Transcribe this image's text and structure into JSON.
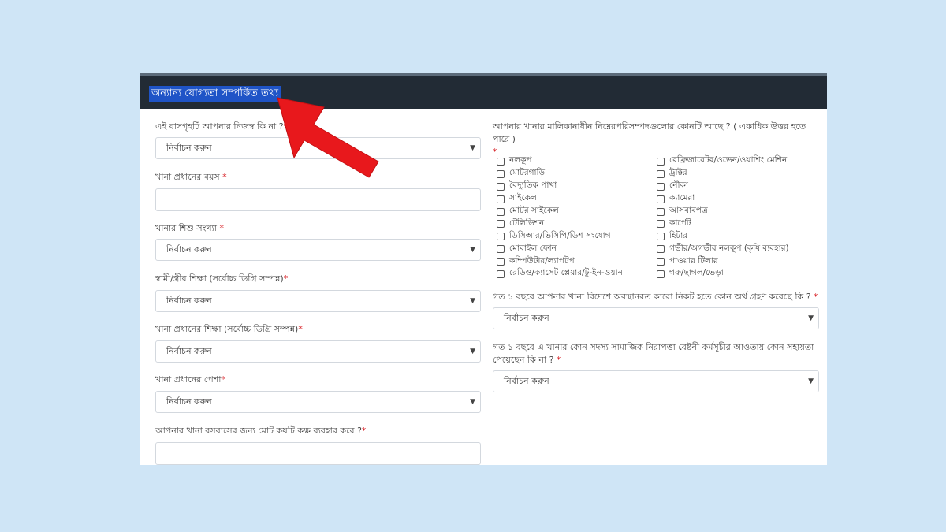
{
  "header": {
    "title": "অন্যান্য যোগ্যতা সম্পর্কিত তথ্য"
  },
  "left_fields": {
    "house_own": {
      "label": "এই বাসগৃহটি আপনার নিজস্ব কি না ?",
      "required": "*",
      "value": "নির্বাচন করুন"
    },
    "head_age": {
      "label": "খানা প্রধানের বয়স",
      "required": " *",
      "value": ""
    },
    "child_count": {
      "label": "খানার শিশু সংখ্যা",
      "required": " *",
      "value": "নির্বাচন করুন"
    },
    "spouse_edu": {
      "label": "স্বামী/স্ত্রীর শিক্ষা (সর্বোচ্চ ডিগ্রি সম্পন্ন)",
      "required": "*",
      "value": "নির্বাচন করুন"
    },
    "head_edu": {
      "label": "খানা প্রধানের শিক্ষা (সর্বোচ্চ ডিগ্রি সম্পন্ন)",
      "required": "*",
      "value": "নির্বাচন করুন"
    },
    "head_job": {
      "label": "খানা প্রধানের পেশা",
      "required": "*",
      "value": "নির্বাচন করুন"
    },
    "rooms": {
      "label": "আপনার খানা বসবাসের জন্য মোট কয়টি কক্ষ ব্যবহার করে ?",
      "required": "*",
      "value": ""
    }
  },
  "assets": {
    "label": "আপনার খানার মালিকানাধীন নিম্নেরপরিসম্পদগুলোর কোনটি আছে ? ( একাধিক উত্তর হতে পারে )",
    "required": "*",
    "col1": [
      "নলকূপ",
      "মোটরগাড়ি",
      "বৈদ্যুতিক পাখা",
      "সাইকেল",
      "মোটর সাইকেল",
      "টেলিভিশন",
      "ডিসিআর/ভিসিপি/ডিশ সংযোগ",
      "মোবাইল ফোন",
      "কম্পিউটার/ল্যাপটপ",
      "রেডিও/ক্যাসেট প্লেয়ার/টু-ইন-ওয়ান"
    ],
    "col2": [
      "রেফ্রিজারেটর/ওভেন/ওয়াশিং মেশিন",
      "ট্রাক্টর",
      "নৌকা",
      "ক্যামেরা",
      "আসবাবপত্র",
      "কার্পেট",
      "হিটার",
      "গভীর/অগভীর নলকূপ (কৃষি ব্যবহার)",
      "পাওয়ার টিলার",
      "গরু/ছাগল/ভেড়া"
    ]
  },
  "right_fields": {
    "remittance": {
      "label": "গত ১ বছরে আপনার খানা বিদেশে অবস্থানরত কারো নিকট হতে কোন অর্থ গ্রহণ করেছে কি ?",
      "required": " *",
      "value": "নির্বাচন করুন"
    },
    "safety_net_1": {
      "label": "গত ১ বছরে এ খানার কোন সদস্য সামাজিক নিরাপত্তা বেষ্টনী কর্মসূচীর আওতায় কোন সহায়তা",
      "label2": "পেয়েছেন কি না ?",
      "required": " *",
      "value": "নির্বাচন করুন"
    }
  },
  "colors": {
    "header_bg": "#222b35",
    "title_highlight": "#1f54c7",
    "required": "#d9262b",
    "arrow": "#e8181c",
    "page_bg": "#cfe5f6"
  },
  "icons": {
    "select_arrow": "chevron-down-icon",
    "annotation": "red-arrow"
  }
}
